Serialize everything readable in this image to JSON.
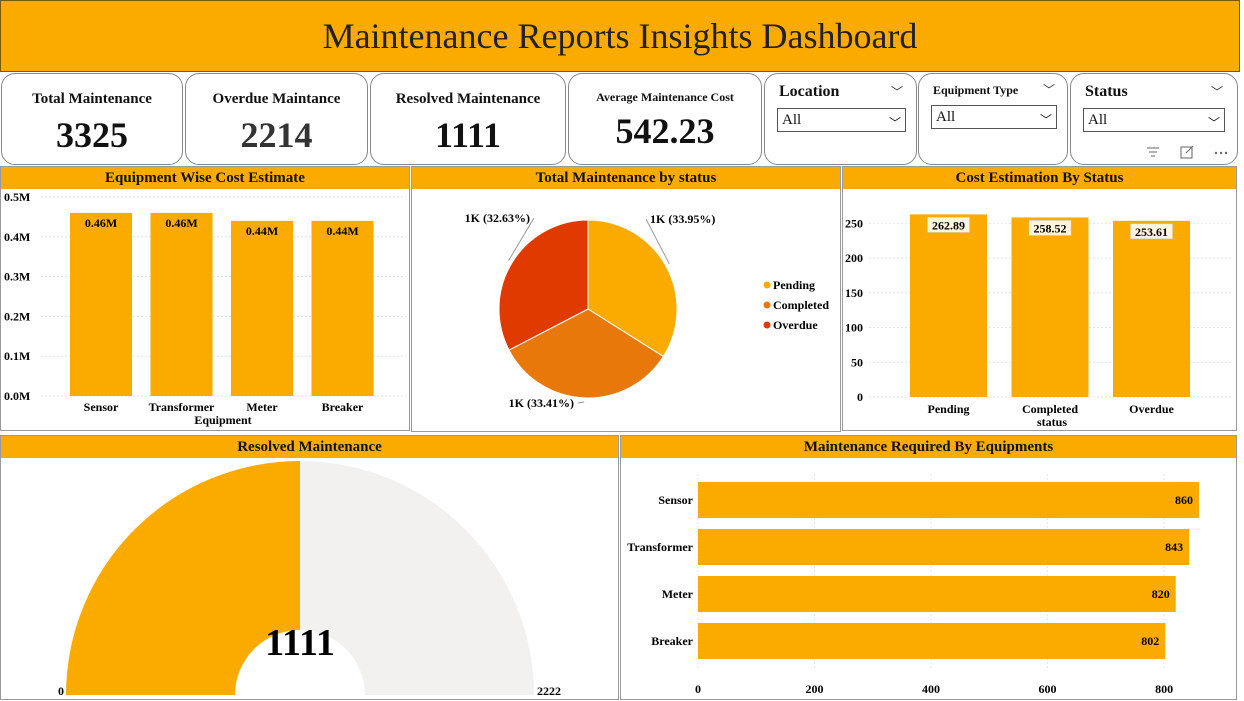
{
  "title": "Maintenance Reports Insights Dashboard",
  "kpis": [
    {
      "label": "Total Maintenance",
      "value": "3325"
    },
    {
      "label": "Overdue Maintance",
      "value": "2214"
    },
    {
      "label": "Resolved Maintenance",
      "value": "1111"
    },
    {
      "label": "Average Maintenance Cost",
      "value": "542.23"
    }
  ],
  "slicers": [
    {
      "title": "Location",
      "selected": "All"
    },
    {
      "title": "Equipment Type",
      "selected": "All"
    },
    {
      "title": "Status",
      "selected": "All"
    }
  ],
  "colors": {
    "accent": "#fbab00",
    "completed": "#e8780a",
    "overdue": "#e03a00",
    "gauge_bg": "#f2f1f0"
  },
  "icons": {
    "filter": "filter-icon",
    "focus": "focus-mode-icon",
    "more": "more-options-icon",
    "chevron": "chevron-down-icon"
  },
  "chart_data": [
    {
      "id": "equip_cost",
      "type": "bar",
      "title": "Equipment Wise Cost Estimate",
      "xlabel": "Equipment",
      "categories": [
        "Sensor",
        "Transformer",
        "Meter",
        "Breaker"
      ],
      "values": [
        0.46,
        0.46,
        0.44,
        0.44
      ],
      "data_labels": [
        "0.46M",
        "0.46M",
        "0.44M",
        "0.44M"
      ],
      "yticks": [
        "0.0M",
        "0.1M",
        "0.2M",
        "0.3M",
        "0.4M",
        "0.5M"
      ],
      "ylim": [
        0,
        0.5
      ]
    },
    {
      "id": "status_pie",
      "type": "pie",
      "title": "Total Maintenance by status",
      "slices": [
        {
          "name": "Pending",
          "percent": 33.95,
          "label": "1K (33.95%)"
        },
        {
          "name": "Completed",
          "percent": 33.41,
          "label": "1K (33.41%)"
        },
        {
          "name": "Overdue",
          "percent": 32.63,
          "label": "1K (32.63%)"
        }
      ],
      "legend": "right"
    },
    {
      "id": "cost_status",
      "type": "bar",
      "title": "Cost Estimation By Status",
      "xlabel": "status",
      "categories": [
        "Pending",
        "Completed",
        "Overdue"
      ],
      "values": [
        262.89,
        258.52,
        253.61
      ],
      "data_labels": [
        "262.89",
        "258.52",
        "253.61"
      ],
      "yticks": [
        "0",
        "50",
        "100",
        "150",
        "200",
        "250"
      ],
      "ylim": [
        0,
        270
      ]
    },
    {
      "id": "gauge",
      "type": "gauge",
      "title": "Resolved Maintenance",
      "value": 1111,
      "value_label": "1111",
      "min_label": "0",
      "max_label": "2222",
      "min": 0,
      "max": 2222
    },
    {
      "id": "equip_req",
      "type": "bar",
      "orientation": "horizontal",
      "title": "Maintenance Required By Equipments",
      "categories": [
        "Sensor",
        "Transformer",
        "Meter",
        "Breaker"
      ],
      "values": [
        860,
        843,
        820,
        802
      ],
      "data_labels": [
        "860",
        "843",
        "820",
        "802"
      ],
      "xticks": [
        "0",
        "200",
        "400",
        "600",
        "800"
      ],
      "xlim": [
        0,
        880
      ]
    }
  ]
}
